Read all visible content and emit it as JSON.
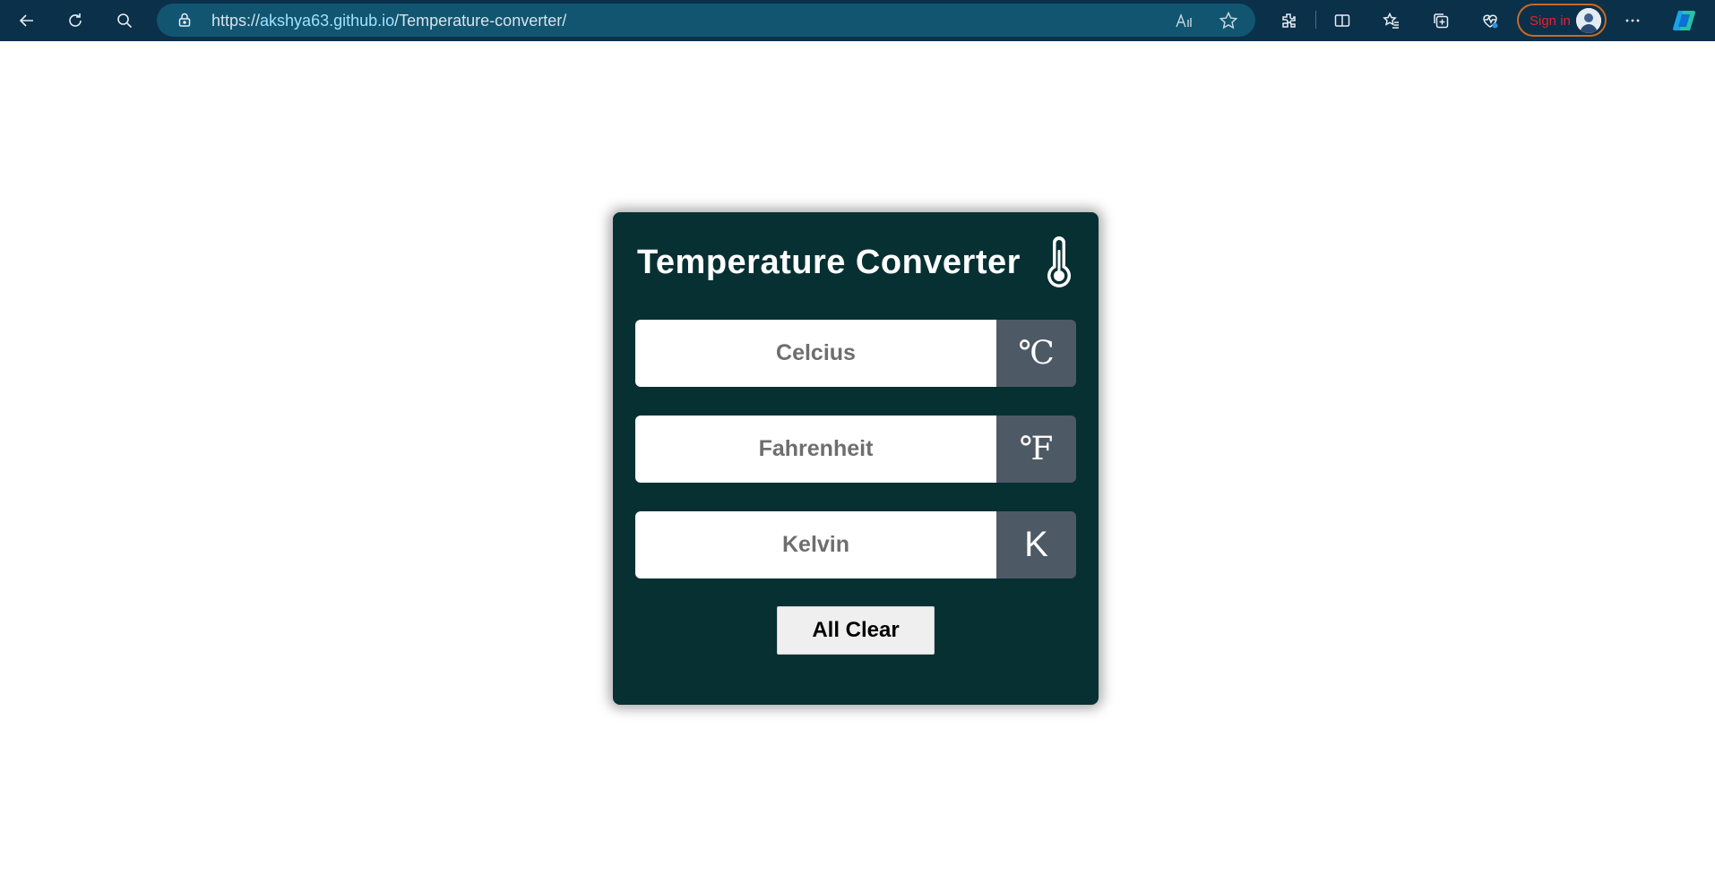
{
  "browser": {
    "url_scheme": "https://",
    "url_host": "akshya63.github.io",
    "url_path": "/Temperature-converter/",
    "signin_label": "Sign in",
    "icons": [
      "back-icon",
      "refresh-icon",
      "search-icon",
      "lock-icon",
      "read-aloud-icon",
      "favorite-star-icon",
      "extensions-icon",
      "split-screen-icon",
      "favorites-icon",
      "collections-icon",
      "browser-essentials-icon",
      "more-icon",
      "copilot-icon"
    ]
  },
  "app": {
    "title": "Temperature Converter",
    "celsius": {
      "placeholder": "Celcius",
      "unit": "℃"
    },
    "fahrenheit": {
      "placeholder": "Fahrenheit",
      "unit": "℉"
    },
    "kelvin": {
      "placeholder": "Kelvin",
      "unit": "K"
    },
    "clear_label": "All Clear"
  },
  "colors": {
    "card_bg": "#073033",
    "unit_bg": "#4d5965",
    "toolbar_bg": "#0b3049",
    "address_bg": "#115571"
  }
}
